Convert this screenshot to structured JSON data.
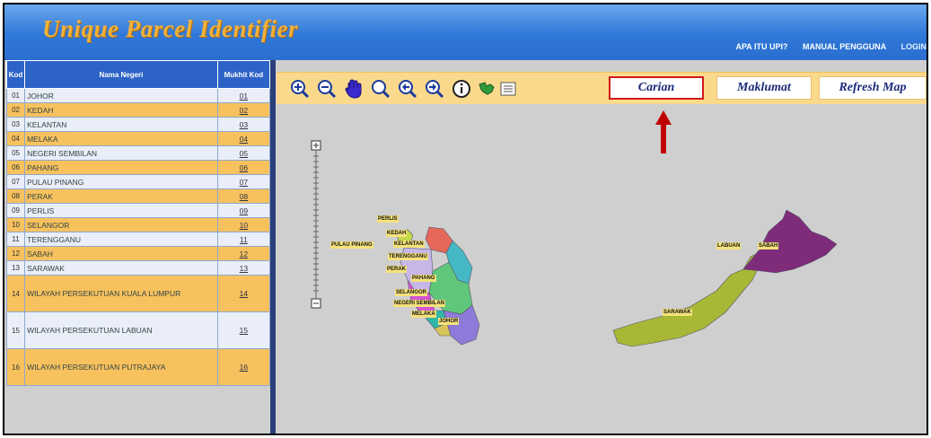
{
  "header": {
    "title": "Unique Parcel Identifier",
    "nav": [
      "APA ITU UPI?",
      "MANUAL PENGGUNA",
      "LOGIN"
    ]
  },
  "table": {
    "headers": [
      "Kod",
      "Nama Negeri",
      "Mukhit Kod"
    ],
    "rows": [
      {
        "kod": "01",
        "nama": "JOHOR",
        "link": "01"
      },
      {
        "kod": "02",
        "nama": "KEDAH",
        "link": "02"
      },
      {
        "kod": "03",
        "nama": "KELANTAN",
        "link": "03"
      },
      {
        "kod": "04",
        "nama": "MELAKA",
        "link": "04"
      },
      {
        "kod": "05",
        "nama": "NEGERI SEMBILAN",
        "link": "05"
      },
      {
        "kod": "06",
        "nama": "PAHANG",
        "link": "06"
      },
      {
        "kod": "07",
        "nama": "PULAU PINANG",
        "link": "07"
      },
      {
        "kod": "08",
        "nama": "PERAK",
        "link": "08"
      },
      {
        "kod": "09",
        "nama": "PERLIS",
        "link": "09"
      },
      {
        "kod": "10",
        "nama": "SELANGOR",
        "link": "10"
      },
      {
        "kod": "11",
        "nama": "TERENGGANU",
        "link": "11"
      },
      {
        "kod": "12",
        "nama": "SABAH",
        "link": "12"
      },
      {
        "kod": "13",
        "nama": "SARAWAK",
        "link": "13"
      },
      {
        "kod": "14",
        "nama": "WILAYAH PERSEKUTUAN KUALA LUMPUR",
        "link": "14"
      },
      {
        "kod": "15",
        "nama": "WILAYAH PERSEKUTUAN LABUAN",
        "link": "15"
      },
      {
        "kod": "16",
        "nama": "WILAYAH PERSEKUTUAN PUTRAJAYA",
        "link": "16"
      }
    ]
  },
  "toolbar": {
    "tools": [
      "zoom-in-icon",
      "zoom-out-icon",
      "pan-hand-icon",
      "zoom-box-icon",
      "previous-extent-icon",
      "next-extent-icon",
      "info-icon",
      "full-extent-map-icon",
      "legend-icon"
    ],
    "buttons": [
      "Carian",
      "Maklumat",
      "Refresh Map"
    ]
  },
  "map": {
    "labels": [
      "PERLIS",
      "KEDAH",
      "PULAU PINANG",
      "KELANTAN",
      "TERENGGANU",
      "PERAK",
      "PAHANG",
      "SELANGOR",
      "NEGERI SEMBILAN",
      "MELAKA",
      "JOHOR",
      "LABUAN",
      "SABAH",
      "SARAWAK"
    ]
  },
  "colors": {
    "header_blue": "#2f77d8",
    "title_gold": "#f0b23a",
    "row_orange": "#f7c15e",
    "row_light": "#e9eef8",
    "toolbar_bg": "#fbd98c",
    "highlight_red": "#d01818"
  }
}
